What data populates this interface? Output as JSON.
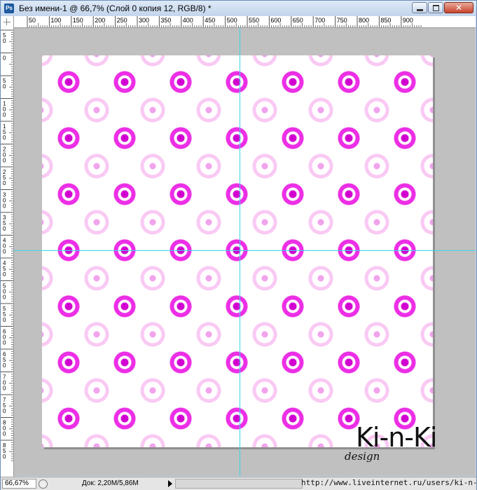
{
  "window": {
    "title": "Без имени-1 @ 66,7% (Слой 0 копия 12, RGB/8) *",
    "app_icon": "Ps",
    "close_glyph": "✕"
  },
  "ruler": {
    "horizontal_labels": [
      "50",
      "100",
      "150",
      "200",
      "250",
      "300",
      "350",
      "400",
      "450",
      "500",
      "550",
      "600",
      "650",
      "700",
      "750",
      "800",
      "850",
      "900"
    ],
    "vertical_labels": [
      "50",
      "0",
      "50",
      "100",
      "150",
      "200",
      "250",
      "300",
      "350",
      "400",
      "450",
      "500",
      "550",
      "600",
      "650",
      "700",
      "750",
      "800",
      "850"
    ]
  },
  "canvas": {
    "watermark_main": "Ki-n-Ki",
    "watermark_sub": "design",
    "pattern_colors": [
      "#d100d1",
      "#ec2ee6",
      "#f1a3ec",
      "#f9c9f3"
    ],
    "guide_color": "#34d8e8"
  },
  "status": {
    "zoom": "66,67%",
    "doc": "Док: 2,20M/5,86M",
    "url": "http://www.liveinternet.ru/users/ki-n-ki/"
  }
}
